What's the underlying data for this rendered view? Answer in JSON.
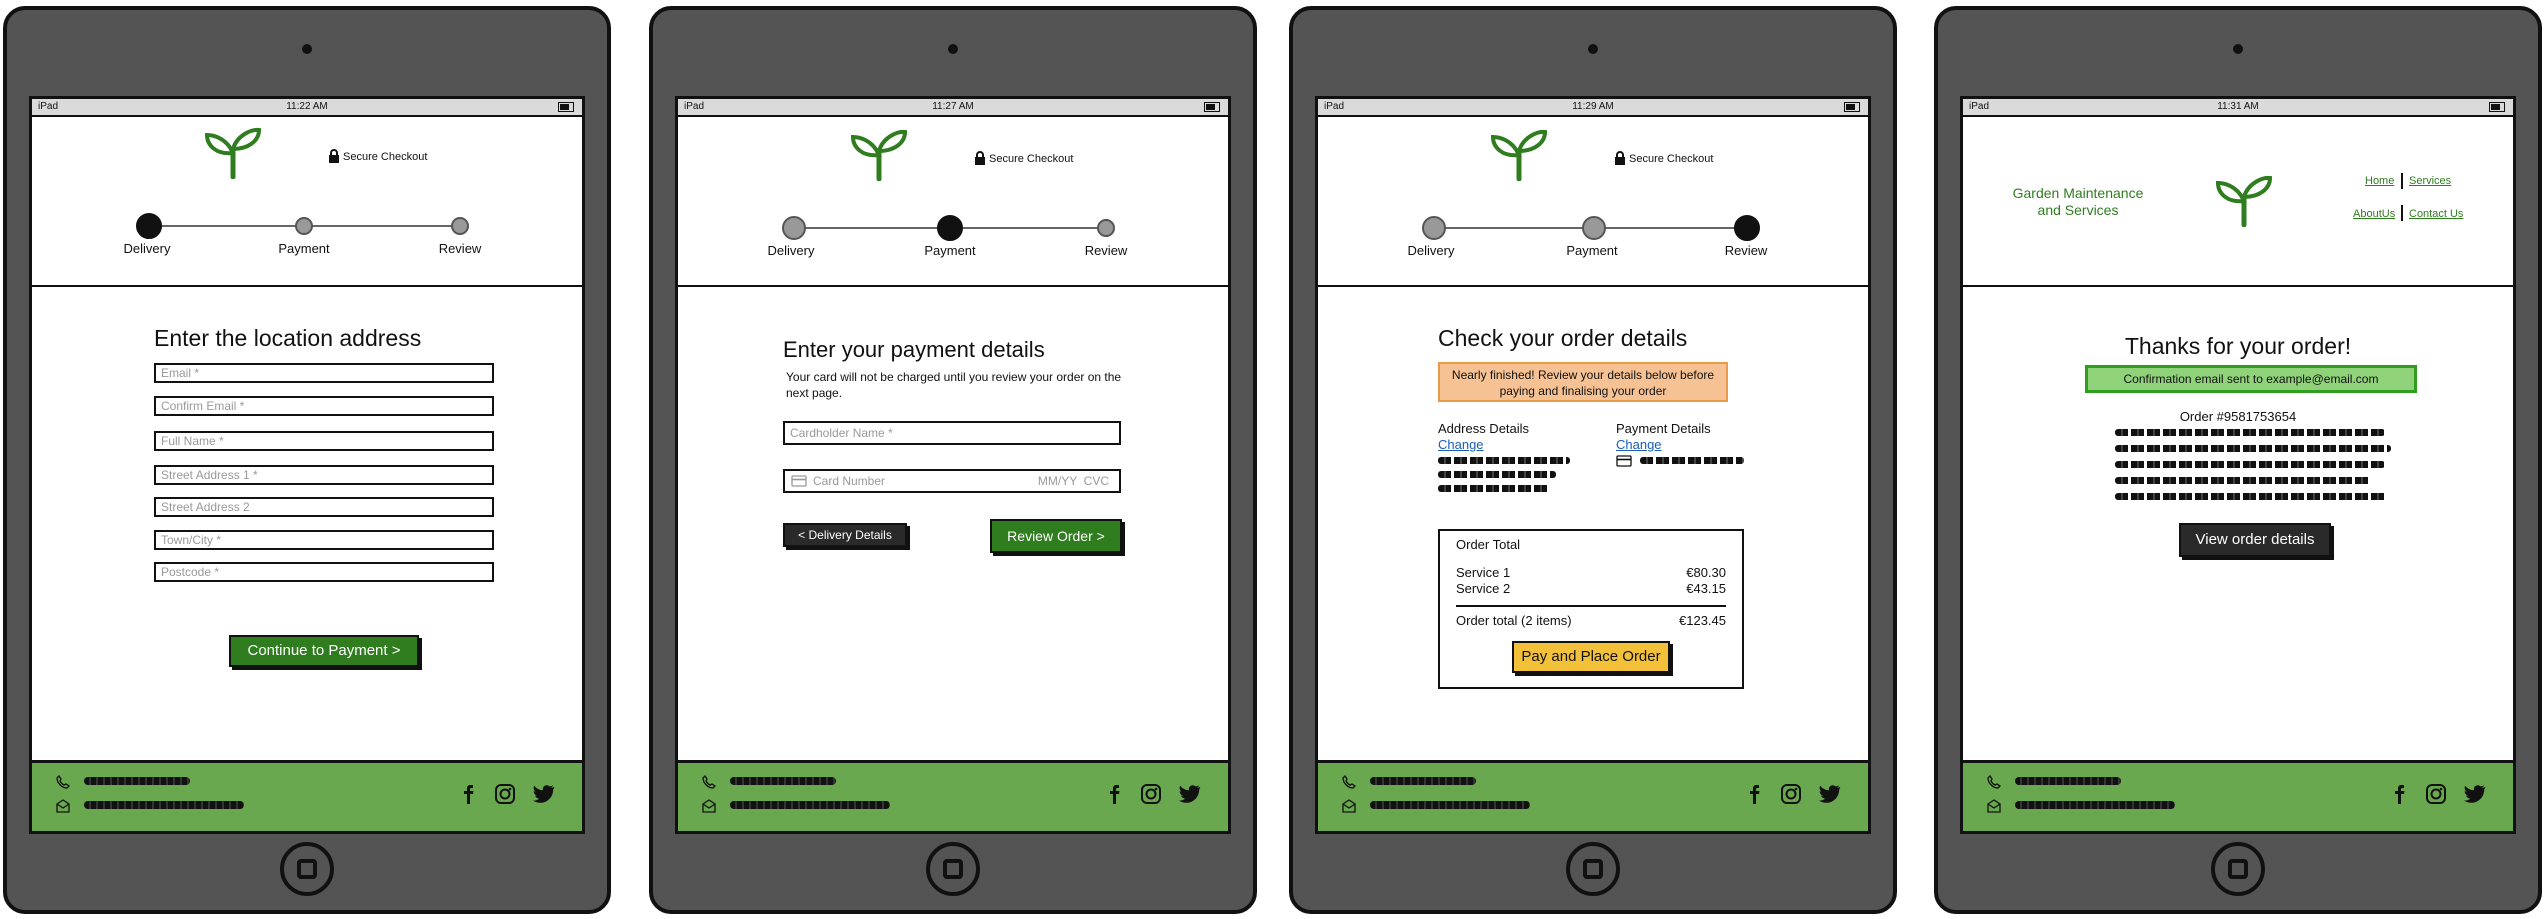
{
  "status_bar": {
    "device": "iPad",
    "times": [
      "11:22 AM",
      "11:27 AM",
      "11:29 AM",
      "11:31 AM"
    ]
  },
  "header": {
    "secure_checkout": "Secure Checkout"
  },
  "steps": [
    "Delivery",
    "Payment",
    "Review"
  ],
  "footer": {
    "phone_icon": "phone-icon",
    "email_icon": "email-icon",
    "social": [
      "facebook-icon",
      "instagram-icon",
      "twitter-icon"
    ]
  },
  "colors": {
    "brand_green": "#2f7d1e",
    "footer_green": "#6aa84f",
    "banner_orange": "#f6c193",
    "banner_green": "#8fd27a",
    "cta_yellow": "#f3c03a"
  },
  "delivery": {
    "heading": "Enter the location address",
    "fields": [
      "Email *",
      "Confirm Email *",
      "Full Name *",
      "Street Address 1 *",
      "Street Address 2",
      "Town/City *",
      "Postcode *"
    ],
    "continue_button": "Continue to Payment >"
  },
  "payment": {
    "heading": "Enter your payment details",
    "note": "Your card will not be charged until you review your order on the next page.",
    "cardholder_placeholder": "Cardholder Name *",
    "card_number_placeholder": "Card Number",
    "expiry_cvc_placeholder": "MM/YY  CVC",
    "back_button": "< Delivery Details",
    "review_button": "Review Order >"
  },
  "review": {
    "heading": "Check your order details",
    "banner": "Nearly finished! Review your details below before paying and finalising your order",
    "address_title": "Address Details",
    "payment_title": "Payment Details",
    "change_link": "Change",
    "order_total_title": "Order Total",
    "items": [
      {
        "name": "Service 1",
        "price": "€80.30"
      },
      {
        "name": "Service 2",
        "price": "€43.15"
      }
    ],
    "total_label": "Order total (2 items)",
    "total_value": "€123.45",
    "pay_button": "Pay and Place Order"
  },
  "confirmation": {
    "site_title_line1": "Garden Maintenance",
    "site_title_line2": "and Services",
    "nav": {
      "home": "Home",
      "services": "Services",
      "about": "AboutUs",
      "contact": "Contact Us"
    },
    "heading": "Thanks for your order!",
    "banner": "Confirmation email sent to example@email.com",
    "order_number": "Order #9581753654",
    "view_button": "View order details"
  }
}
